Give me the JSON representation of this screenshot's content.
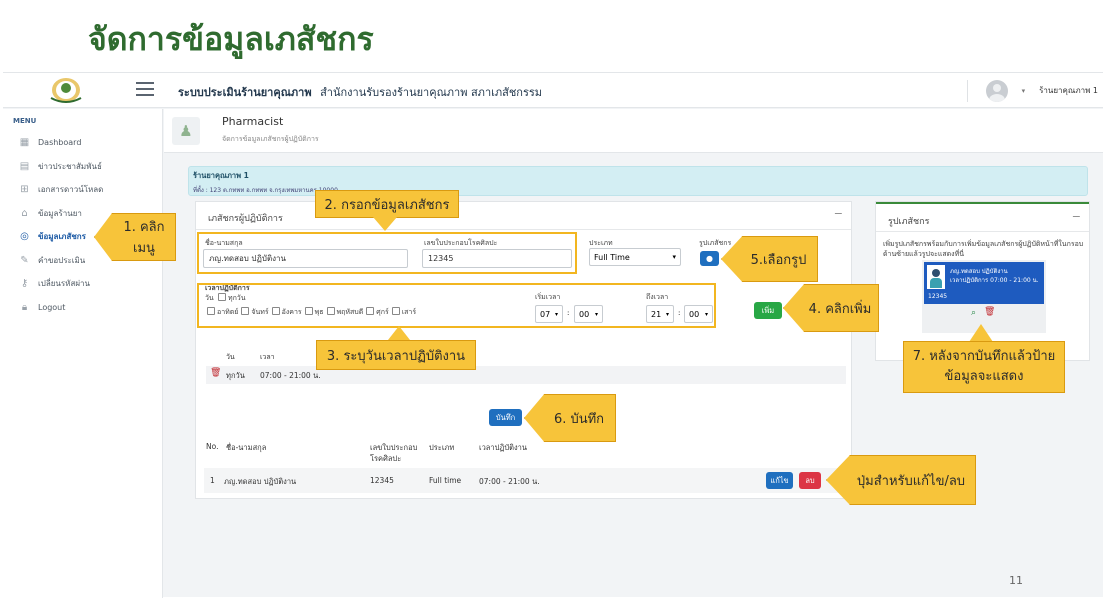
{
  "slide": {
    "title": "จัดการข้อมูลเภสัชกร",
    "page_number": "11"
  },
  "topbar": {
    "system_name_bold": "ระบบประเมินร้านยาคุณภาพ",
    "system_name_rest": "สำนักงานรับรองร้านยาคุณภาพ สภาเภสัชกรรม",
    "user_name": "ร้านยาคุณภาพ 1"
  },
  "sidebar": {
    "menu_label": "MENU",
    "items": [
      {
        "label": "Dashboard",
        "icon": "grid-icon"
      },
      {
        "label": "ข่าวประชาสัมพันธ์",
        "icon": "news-icon"
      },
      {
        "label": "เอกสารดาวน์โหลด",
        "icon": "download-icon"
      },
      {
        "label": "ข้อมูลร้านยา",
        "icon": "home-icon"
      },
      {
        "label": "ข้อมูลเภสัชกร",
        "icon": "user-icon",
        "active": true
      },
      {
        "label": "คำขอประเมิน",
        "icon": "edit-icon"
      },
      {
        "label": "เปลี่ยนรหัสผ่าน",
        "icon": "key-icon"
      },
      {
        "label": "Logout",
        "icon": "lock-icon"
      }
    ]
  },
  "page_header": {
    "title": "Pharmacist",
    "subtitle": "จัดการข้อมูลเภสัชกรผู้ปฏิบัติการ"
  },
  "shop": {
    "name": "ร้านยาคุณภาพ 1",
    "address": "ที่ตั้ง : 123 ต.กทพท อ.กทพท จ.กรุงเทพมหานคร 10000"
  },
  "form": {
    "panel_title": "เภสัชกรผู้ปฏิบัติการ",
    "name_label": "ชื่อ-นามสกุล",
    "name_value": "ภญ.ทดสอบ ปฏิบัติงาน",
    "license_label": "เลขใบประกอบโรคศิลปะ",
    "license_value": "12345",
    "type_label": "ประเภท",
    "type_value": "Full Time",
    "photo_label": "รูปเภสัชกร",
    "work_time_label": "เวลาปฏิบัติการ",
    "day_label": "วัน",
    "everyday_label": "ทุกวัน",
    "days": [
      "อาทิตย์",
      "จันทร์",
      "อังคาร",
      "พุธ",
      "พฤหัสบดี",
      "ศุกร์",
      "เสาร์"
    ],
    "start_label": "เริ่มเวลา",
    "start_hour": "07",
    "start_min": "00",
    "end_label": "ถึงเวลา",
    "end_hour": "21",
    "end_min": "00",
    "add_button": "เพิ่ม",
    "schedule_col_day": "วัน",
    "schedule_col_time": "เวลา",
    "schedule_day": "ทุกวัน",
    "schedule_time": "07:00 - 21:00 น.",
    "save_button": "บันทึก"
  },
  "table": {
    "headers": [
      "No.",
      "ชื่อ-นามสกุล",
      "เลขใบประกอบ โรคศิลปะ",
      "ประเภท",
      "เวลาปฏิบัติงาน"
    ],
    "rows": [
      {
        "no": "1",
        "name": "ภญ.ทดสอบ ปฏิบัติงาน",
        "license": "12345",
        "type": "Full time",
        "time": "07:00 - 21:00 น."
      }
    ],
    "edit_button": "แก้ไข",
    "delete_button": "ลบ"
  },
  "photo_panel": {
    "title": "รูปเภสัชกร",
    "description": "เพิ่มรูปเภสัชกรพร้อมกับการเพิ่มข้อมูลเภสัชกรผู้ปฏิบัติหน้าที่ในกรอบด้านซ้ายแล้วรูปจะแสดงที่นี่",
    "card_name": "ภญ.ทดสอบ ปฏิบัติงาน",
    "card_time": "เวลาปฏิบัติการ 07:00 - 21:00 น.",
    "card_license": "12345"
  },
  "callouts": {
    "c1": "1. คลิกเมนู",
    "c2": "2. กรอกข้อมูลเภสัชกร",
    "c3": "3. ระบุวันเวลาปฏิบัติงาน",
    "c4": "4. คลิกเพิ่ม",
    "c5": "5.เลือกรูป",
    "c6": "6. บันทึก",
    "c7": "7. หลังจากบันทึกแล้วป้ายข้อมูลจะแสดง",
    "c8": "ปุ่มสำหรับแก้ไข/ลบ"
  },
  "colors": {
    "title_green": "#2f6b2f",
    "callout_yellow": "#f7c43a",
    "btn_blue": "#1f6fbf",
    "btn_green": "#28a745",
    "btn_red": "#dc3545",
    "card_blue": "#1e5bbf"
  }
}
